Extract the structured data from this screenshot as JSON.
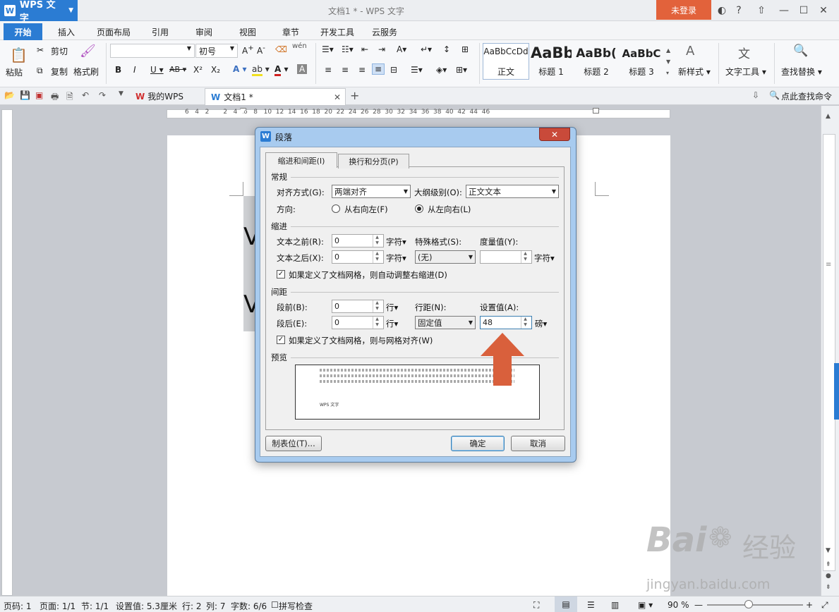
{
  "app": {
    "name": "WPS 文字",
    "window_title": "文档1 * - WPS 文字",
    "login": "未登录"
  },
  "menu": {
    "tabs": [
      "开始",
      "插入",
      "页面布局",
      "引用",
      "审阅",
      "视图",
      "章节",
      "开发工具",
      "云服务"
    ]
  },
  "ribbon": {
    "paste": "粘贴",
    "cut": "剪切",
    "copy": "复制",
    "format_painter": "格式刷",
    "font_size": "初号",
    "styles": [
      {
        "preview": "AaBbCcDd",
        "name": "正文"
      },
      {
        "preview": "AaBb",
        "name": "标题 1"
      },
      {
        "preview": "AaBb(",
        "name": "标题 2"
      },
      {
        "preview": "AaBbC",
        "name": "标题 3"
      }
    ],
    "new_style": "新样式",
    "text_tools": "文字工具",
    "find_replace": "查找替换"
  },
  "tabs": {
    "my_wps": "我的WPS",
    "doc": "文档1 *",
    "search_cmd": "点此查找命令"
  },
  "ruler": {
    "h_marks": "6   4   2       2   4   6   8   10  12  14  16  18  20  22  24  26  28  30  32  34  36  38  40  42  44  46"
  },
  "document": {
    "letter": "V"
  },
  "dialog": {
    "title": "段落",
    "close": "✕",
    "tabs": [
      "缩进和间距(I)",
      "换行和分页(P)"
    ],
    "general": {
      "group": "常规",
      "align_label": "对齐方式(G):",
      "align_value": "两端对齐",
      "outline_label": "大纲级别(O):",
      "outline_value": "正文文本",
      "direction_label": "方向:",
      "rtl": "从右向左(F)",
      "ltr": "从左向右(L)"
    },
    "indent": {
      "group": "缩进",
      "before_label": "文本之前(R):",
      "before_value": "0",
      "after_label": "文本之后(X):",
      "after_value": "0",
      "unit": "字符▾",
      "special_label": "特殊格式(S):",
      "special_value": "(无)",
      "measure_label": "度量值(Y):",
      "measure_value": "",
      "auto_adjust": "如果定义了文档网格，则自动调整右缩进(D)"
    },
    "spacing": {
      "group": "间距",
      "before_label": "段前(B):",
      "before_value": "0",
      "after_label": "段后(E):",
      "after_value": "0",
      "unit": "行▾",
      "line_label": "行距(N):",
      "line_value": "固定值",
      "set_label": "设置值(A):",
      "set_value": "48",
      "set_unit": "磅▾",
      "snap_grid": "如果定义了文档网格，则与网格对齐(W)"
    },
    "preview": {
      "group": "预览",
      "sample": "WPS 文字"
    },
    "buttons": {
      "tabs": "制表位(T)...",
      "ok": "确定",
      "cancel": "取消"
    }
  },
  "status": {
    "page": "页码: 1",
    "pages": "页面: 1/1",
    "section": "节: 1/1",
    "setting": "设置值: 5.3厘米",
    "row": "行: 2",
    "col": "列: 7",
    "words": "字数: 6/6",
    "spell": "拼写检查",
    "zoom": "90 %"
  },
  "watermark": {
    "text1": "Bai",
    "text2": "经验",
    "url": "jingyan.baidu.com"
  },
  "colors": {
    "accent": "#2b7cd3",
    "login": "#e2623b",
    "arrow": "#d9603c"
  }
}
